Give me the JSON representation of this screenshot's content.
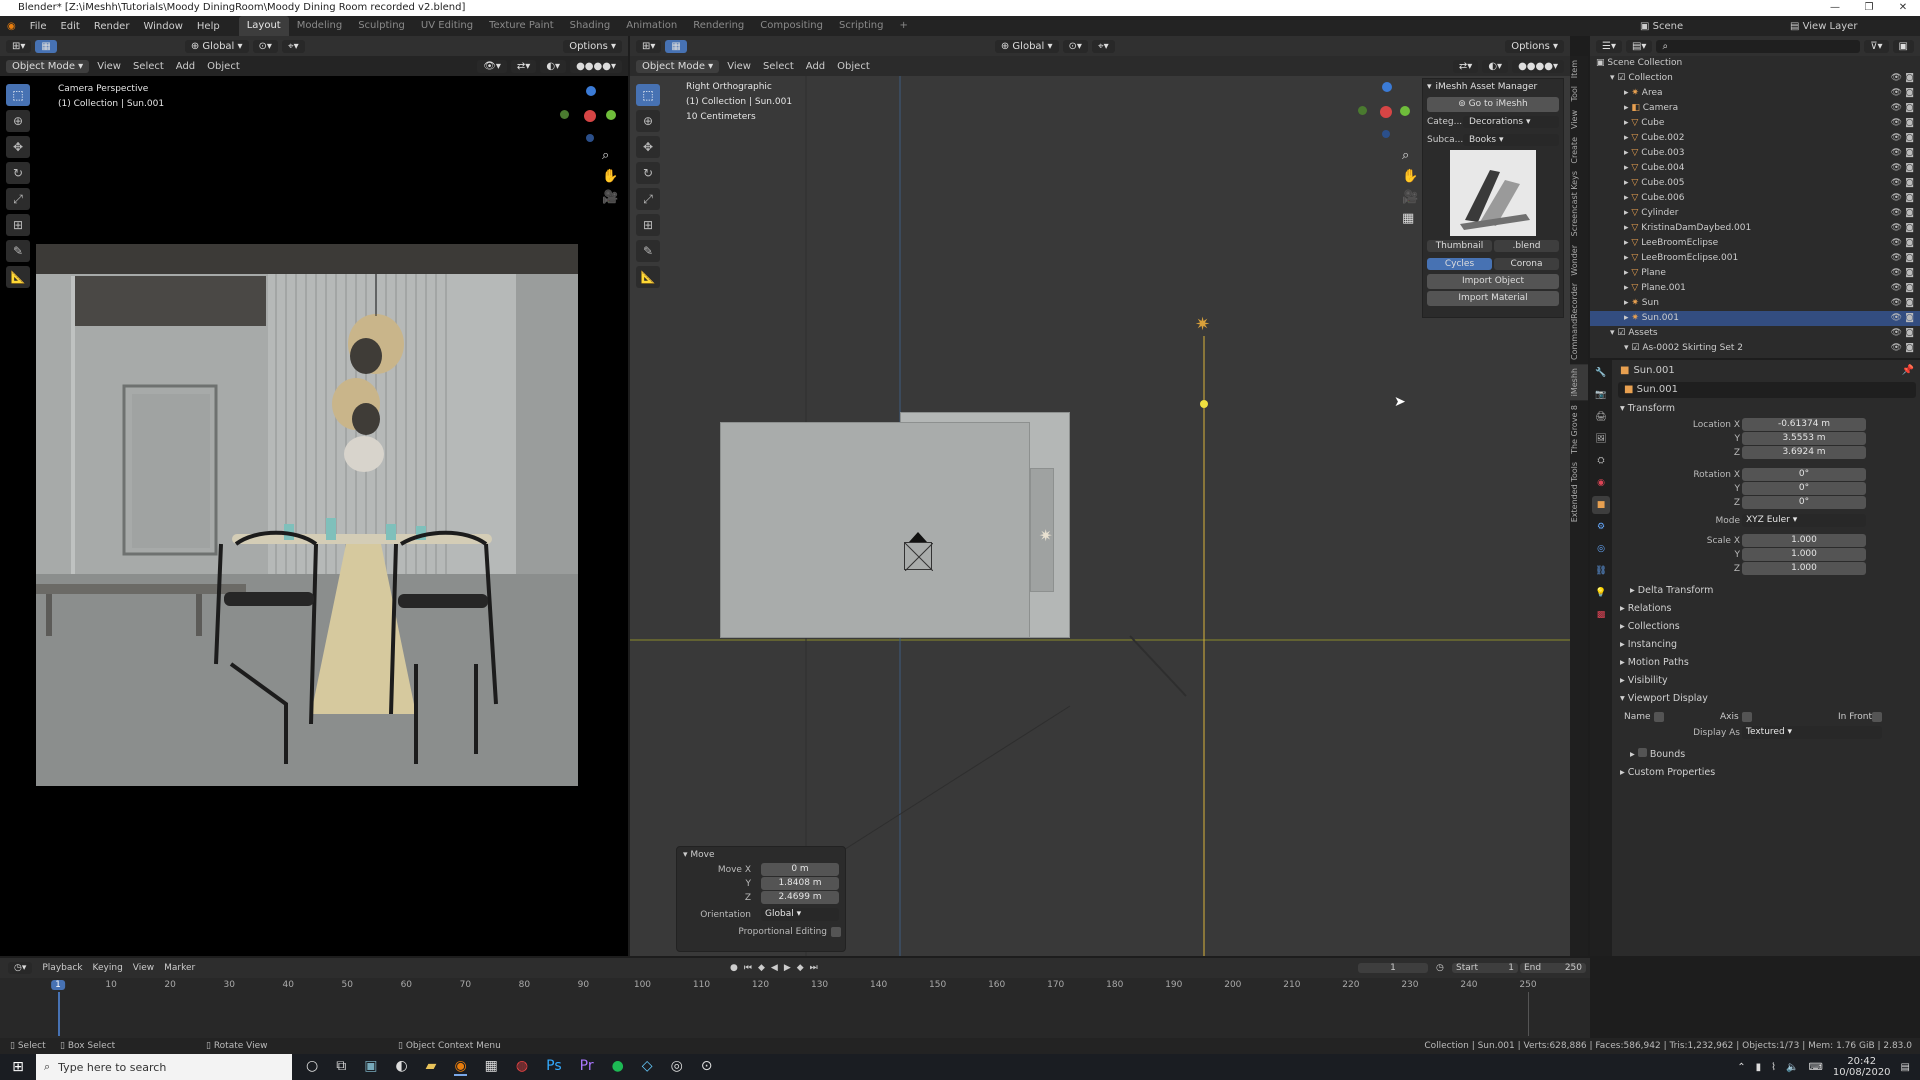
{
  "window": {
    "title": "Blender* [Z:\\iMeshh\\Tutorials\\Moody DiningRoom\\Moody Dining Room recorded v2.blend]"
  },
  "menu": [
    "File",
    "Edit",
    "Render",
    "Window",
    "Help"
  ],
  "workspaces": [
    "Layout",
    "Modeling",
    "Sculpting",
    "UV Editing",
    "Texture Paint",
    "Shading",
    "Animation",
    "Rendering",
    "Compositing",
    "Scripting"
  ],
  "active_workspace": "Layout",
  "topbar": {
    "scene_label": "Scene",
    "view_layer_label": "View Layer"
  },
  "left_viewport": {
    "mode": "Object Mode",
    "menus": [
      "View",
      "Select",
      "Add",
      "Object"
    ],
    "orientation": "Global",
    "options": "Options",
    "overlay_title": "Camera Perspective",
    "overlay_sub": "(1) Collection | Sun.001"
  },
  "right_viewport": {
    "mode": "Object Mode",
    "menus": [
      "View",
      "Select",
      "Add",
      "Object"
    ],
    "orientation": "Global",
    "options": "Options",
    "overlay_title": "Right Orthographic",
    "overlay_sub": "(1) Collection | Sun.001",
    "overlay_scale": "10 Centimeters"
  },
  "imeshh_panel": {
    "title": "iMeshh Asset Manager",
    "goto_button": "Go to iMeshh",
    "category_label": "Categ...",
    "category_value": "Decorations",
    "subcategory_label": "Subca...",
    "subcategory_value": "Books",
    "thumbnail_tab": "Thumbnail",
    "blend_tab": ".blend",
    "engine_cycles": "Cycles",
    "engine_corona": "Corona",
    "import_object": "Import Object",
    "import_material": "Import Material"
  },
  "side_tabs": [
    "Item",
    "Tool",
    "View",
    "Create",
    "Screencast Keys",
    "Wonder",
    "CommandRecorder",
    "iMeshh",
    "The Grove 8",
    "Extended Tools"
  ],
  "move_panel": {
    "title": "Move",
    "move_x_label": "Move X",
    "move_x": "0 m",
    "y_label": "Y",
    "y": "1.8408 m",
    "z_label": "Z",
    "z": "2.4699 m",
    "orientation_label": "Orientation",
    "orientation": "Global",
    "proportional_label": "Proportional Editing"
  },
  "outliner": {
    "search_placeholder": "",
    "root": "Scene Collection",
    "items": [
      {
        "name": "Collection",
        "indent": 1,
        "type": "collection",
        "icon_color": "#dddddd"
      },
      {
        "name": "Area",
        "indent": 2,
        "type": "light",
        "icon_color": "#e8a050"
      },
      {
        "name": "Camera",
        "indent": 2,
        "type": "camera",
        "icon_color": "#e8a050"
      },
      {
        "name": "Cube",
        "indent": 2,
        "type": "mesh",
        "icon_color": "#e8a050"
      },
      {
        "name": "Cube.002",
        "indent": 2,
        "type": "mesh",
        "icon_color": "#e8a050"
      },
      {
        "name": "Cube.003",
        "indent": 2,
        "type": "mesh",
        "icon_color": "#e8a050"
      },
      {
        "name": "Cube.004",
        "indent": 2,
        "type": "mesh",
        "icon_color": "#e8a050"
      },
      {
        "name": "Cube.005",
        "indent": 2,
        "type": "mesh",
        "icon_color": "#e8a050"
      },
      {
        "name": "Cube.006",
        "indent": 2,
        "type": "mesh",
        "icon_color": "#e8a050"
      },
      {
        "name": "Cylinder",
        "indent": 2,
        "type": "mesh",
        "icon_color": "#e8a050"
      },
      {
        "name": "KristinaDamDaybed.001",
        "indent": 2,
        "type": "mesh",
        "icon_color": "#e8a050"
      },
      {
        "name": "LeeBroomEclipse",
        "indent": 2,
        "type": "mesh",
        "icon_color": "#e8a050"
      },
      {
        "name": "LeeBroomEclipse.001",
        "indent": 2,
        "type": "mesh",
        "icon_color": "#e8a050"
      },
      {
        "name": "Plane",
        "indent": 2,
        "type": "mesh",
        "icon_color": "#e8a050"
      },
      {
        "name": "Plane.001",
        "indent": 2,
        "type": "mesh",
        "icon_color": "#e8a050"
      },
      {
        "name": "Sun",
        "indent": 2,
        "type": "light",
        "icon_color": "#e8a050"
      },
      {
        "name": "Sun.001",
        "indent": 2,
        "type": "light",
        "icon_color": "#e8a050",
        "selected": true
      },
      {
        "name": "Assets",
        "indent": 1,
        "type": "collection",
        "icon_color": "#dddddd"
      },
      {
        "name": "As-0002 Skirting Set 2",
        "indent": 2,
        "type": "collection",
        "icon_color": "#dddddd"
      }
    ]
  },
  "properties": {
    "object_name": "Sun.001",
    "object_field": "Sun.001",
    "transform_section": "Transform",
    "location_x_label": "Location X",
    "location_x": "-0.61374 m",
    "location_y": "3.5553 m",
    "location_z": "3.6924 m",
    "rotation_x_label": "Rotation X",
    "rotation_x": "0°",
    "rotation_y": "0°",
    "rotation_z": "0°",
    "mode_label": "Mode",
    "mode_value": "XYZ Euler",
    "scale_x_label": "Scale X",
    "scale_x": "1.000",
    "scale_y": "1.000",
    "scale_z": "1.000",
    "y_label": "Y",
    "z_label": "Z",
    "delta_transform": "Delta Transform",
    "sections": [
      "Relations",
      "Collections",
      "Instancing",
      "Motion Paths",
      "Visibility"
    ],
    "viewport_display": "Viewport Display",
    "name_label": "Name",
    "axis_label": "Axis",
    "in_front_label": "In Front",
    "display_as_label": "Display As",
    "display_as_value": "Textured",
    "bounds_label": "Bounds",
    "custom_properties": "Custom Properties"
  },
  "timeline": {
    "menus": [
      "Playback",
      "Keying",
      "View",
      "Marker"
    ],
    "current_frame": "1",
    "start_label": "Start",
    "start": "1",
    "end_label": "End",
    "end": "250",
    "ticks": [
      "1",
      "10",
      "20",
      "30",
      "40",
      "50",
      "60",
      "70",
      "80",
      "90",
      "100",
      "110",
      "120",
      "130",
      "140",
      "150",
      "160",
      "170",
      "180",
      "190",
      "200",
      "210",
      "220",
      "230",
      "240",
      "250"
    ]
  },
  "statusbar": {
    "select": "Select",
    "box_select": "Box Select",
    "rotate_view": "Rotate View",
    "context_menu": "Object Context Menu",
    "stats": "Collection | Sun.001 | Verts:628,886 | Faces:586,942 | Tris:1,232,962 | Objects:1/73 | Mem: 1.76 GiB | 2.83.0"
  },
  "taskbar": {
    "search_placeholder": "Type here to search",
    "time": "20:42",
    "date": "10/08/2020"
  }
}
